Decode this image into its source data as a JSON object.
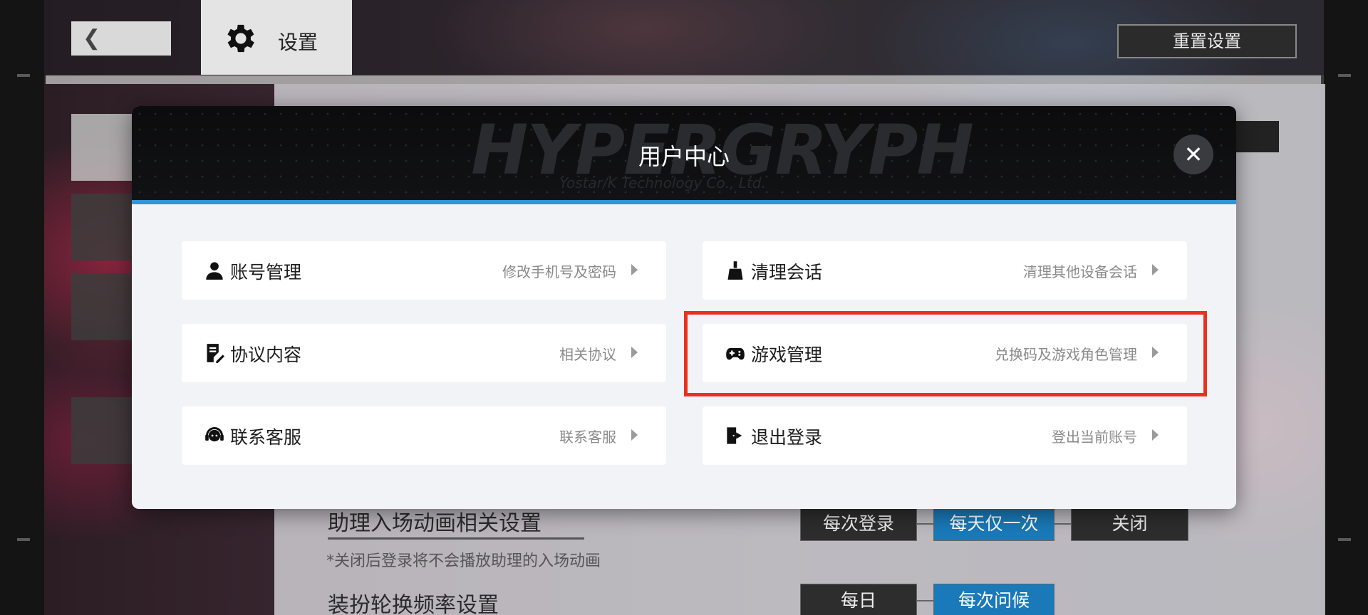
{
  "topbar": {
    "back_icon": "chevron-left-icon",
    "settings_icon": "gear-icon",
    "settings_label": "设置",
    "reset_button": "重置设置"
  },
  "background_settings": {
    "row1": {
      "title": "助理入场动画相关设置",
      "note": "*关闭后登录将不会播放助理的入场动画",
      "options": [
        "每次登录",
        "每天仅一次",
        "关闭"
      ],
      "selected": "每天仅一次"
    },
    "row2": {
      "title": "装扮轮换频率设置",
      "options": [
        "每日",
        "每次问候"
      ],
      "selected": "每次问候"
    }
  },
  "modal": {
    "title": "用户中心",
    "watermark": "HYPERGRYPH",
    "watermark_sub": "Yostar/K Technology Co., Ltd.",
    "close_icon": "close-icon",
    "accent_color": "#2f95d8",
    "items": [
      {
        "icon": "user-icon",
        "label": "账号管理",
        "desc": "修改手机号及密码"
      },
      {
        "icon": "broom-icon",
        "label": "清理会话",
        "desc": "清理其他设备会话"
      },
      {
        "icon": "document-edit-icon",
        "label": "协议内容",
        "desc": "相关协议"
      },
      {
        "icon": "gamepad-icon",
        "label": "游戏管理",
        "desc": "兑换码及游戏角色管理"
      },
      {
        "icon": "headset-icon",
        "label": "联系客服",
        "desc": "联系客服"
      },
      {
        "icon": "logout-icon",
        "label": "退出登录",
        "desc": "登出当前账号"
      }
    ],
    "highlighted_item": "游戏管理",
    "highlight_color": "#e8321f"
  }
}
